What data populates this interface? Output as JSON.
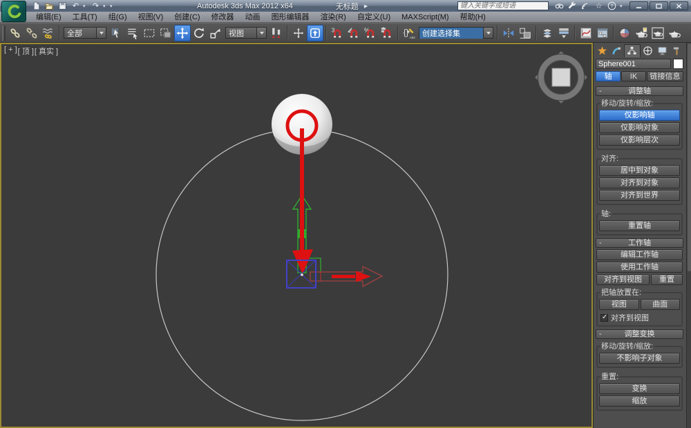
{
  "titlebar": {
    "app_title": "Autodesk 3ds Max 2012 x64",
    "doc_title": "无标题",
    "search_placeholder": "键入关键字或短语",
    "icons": [
      "max-logo-icon",
      "new-file-icon",
      "open-file-icon",
      "save-file-icon",
      "undo-icon",
      "redo-icon",
      "quick-access-dropdown-icon",
      "infocenter-arrow-icon",
      "search-binoculars-icon",
      "subscription-wrench-icon",
      "communication-center-icon",
      "favorites-star-icon",
      "help-icon",
      "minimize-icon",
      "maximize-icon",
      "close-icon"
    ]
  },
  "menubar": {
    "items": [
      "编辑(E)",
      "工具(T)",
      "组(G)",
      "视图(V)",
      "创建(C)",
      "修改器",
      "动画",
      "图形编辑器",
      "渲染(R)",
      "自定义(U)",
      "MAXScript(M)",
      "帮助(H)"
    ]
  },
  "toolbar": {
    "selection_filter_value": "全部",
    "reference_coordinate_value": "视图",
    "named_selection_value": "创建选择集",
    "active_tools": [
      "select-and-move",
      "keyboard-override-toggle"
    ],
    "icons": [
      "select-and-link-icon",
      "unlink-selection-icon",
      "bind-to-space-warp-icon",
      "select-object-icon",
      "select-by-name-icon",
      "rectangular-region-icon",
      "window-crossing-icon",
      "select-and-move-icon",
      "select-and-rotate-icon",
      "select-and-scale-icon",
      "use-pivot-center-icon",
      "select-and-manipulate-icon",
      "keyboard-override-icon",
      "snap-3d-icon",
      "angle-snap-icon",
      "percent-snap-icon",
      "spinner-snap-icon",
      "edit-named-sets-icon",
      "mirror-icon",
      "align-icon",
      "manage-layers-icon",
      "ribbon-toggle-icon",
      "curve-editor-icon",
      "schematic-view-icon",
      "material-editor-icon",
      "render-setup-icon",
      "rendered-frame-icon",
      "render-production-icon"
    ]
  },
  "viewport": {
    "label_menu": "[ + ]",
    "label_view": "[ 顶 ]",
    "label_shading": "[ 真实 ]",
    "background": "#3b3b3b",
    "border_color": "#9c8a33",
    "scene": {
      "selected_object": "Sphere001",
      "colors": {
        "circle_spline": "#c8c8c8",
        "sphere": "#f0f0f0",
        "annotation": "#dd1111",
        "gizmo_y": "#2fae2f",
        "gizmo_x": "#a24040",
        "gizmo_box": "#4242c8"
      }
    }
  },
  "command_panel": {
    "panel_tabs": [
      "create",
      "modify",
      "hierarchy",
      "motion",
      "display",
      "utilities"
    ],
    "active_panel_tab": "hierarchy",
    "object_name": "Sphere001",
    "accent_color": "#3b82de",
    "tabs": [
      {
        "label": "轴",
        "active": true
      },
      {
        "label": "IK",
        "active": false
      },
      {
        "label": "链接信息",
        "active": false
      }
    ],
    "adjust_pivot": {
      "title": "调整轴",
      "move_group_label": "移动/旋转/缩放:",
      "affect_pivot_only": "仅影响轴",
      "affect_object_only": "仅影响对象",
      "affect_hierarchy_only": "仅影响层次",
      "align_group_label": "对齐:",
      "center_to_object": "居中到对象",
      "align_to_object": "对齐到对象",
      "align_to_world": "对齐到世界",
      "pivot_group_label": "轴:",
      "reset_pivot": "重置轴"
    },
    "working_pivot": {
      "title": "工作轴",
      "edit_working_pivot": "编辑工作轴",
      "use_working_pivot": "使用工作轴",
      "align_to_view": "对齐到视图",
      "reset": "重置",
      "place_group_label": "把轴放置在:",
      "view_button": "视图",
      "surface_button": "曲面",
      "align_checkbox_label": "对齐到视图",
      "align_checkbox_checked": true
    },
    "adjust_transform": {
      "title": "调整变换",
      "move_group_label": "移动/旋转/缩放:",
      "dont_affect_children": "不影响子对象",
      "reset_group_label": "重置:",
      "reset_transform": "变换",
      "reset_scale": "缩放"
    }
  }
}
